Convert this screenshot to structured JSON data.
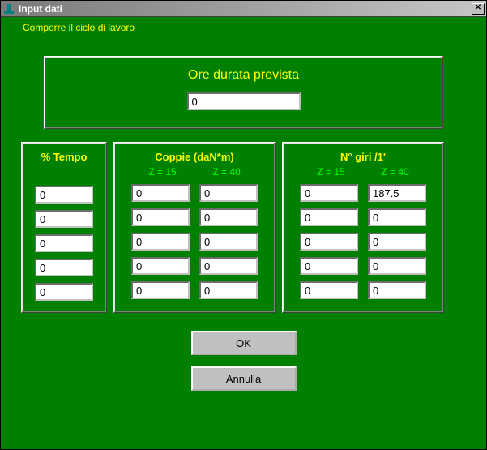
{
  "window": {
    "title": "Input   dati"
  },
  "fieldset": {
    "legend": "Comporre il ciclo di lavoro"
  },
  "top": {
    "label": "Ore durata prevista",
    "value": "0"
  },
  "columns": {
    "tempo": {
      "header": "% Tempo",
      "values": [
        "0",
        "0",
        "0",
        "0",
        "0"
      ]
    },
    "coppie": {
      "header": "Coppie (daN*m)",
      "sub1": "Z = 15",
      "sub2": "Z = 40",
      "col1": [
        "0",
        "0",
        "0",
        "0",
        "0"
      ],
      "col2": [
        "0",
        "0",
        "0",
        "0",
        "0"
      ]
    },
    "giri": {
      "header": "N° giri /1'",
      "sub1": "Z = 15",
      "sub2": "Z = 40",
      "col1": [
        "0",
        "0",
        "0",
        "0",
        "0"
      ],
      "col2": [
        "187.5",
        "0",
        "0",
        "0",
        "0"
      ]
    }
  },
  "buttons": {
    "ok": "OK",
    "cancel": "Annulla"
  }
}
